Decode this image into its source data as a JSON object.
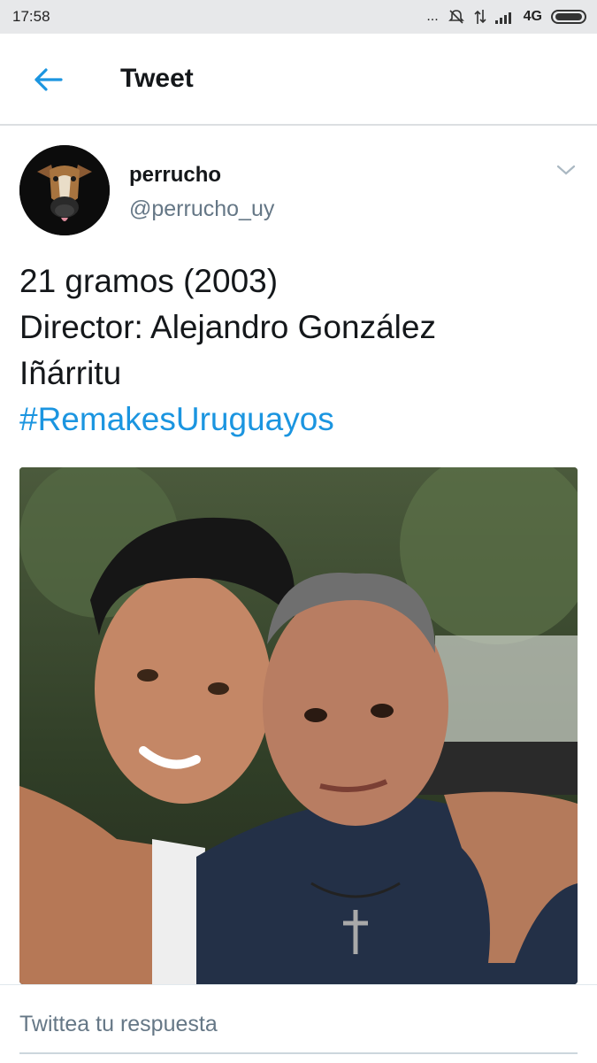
{
  "status_bar": {
    "time": "17:58",
    "network": "4G",
    "dots": "..."
  },
  "app_bar": {
    "title": "Tweet"
  },
  "tweet": {
    "display_name": "perrucho",
    "handle": "@perrucho_uy",
    "text_lines": [
      "21 gramos (2003)",
      "Director: Alejandro González",
      "Iñárritu"
    ],
    "hashtag": "#RemakesUruguayos"
  },
  "reply": {
    "placeholder": "Twittea tu respuesta"
  },
  "colors": {
    "link": "#1b95e0",
    "secondary": "#657786",
    "status_bg": "#e7e8ea"
  },
  "icons": [
    "back-arrow-icon",
    "chevron-down-icon",
    "mute-icon",
    "data-arrows-icon",
    "signal-icon",
    "battery-icon"
  ]
}
